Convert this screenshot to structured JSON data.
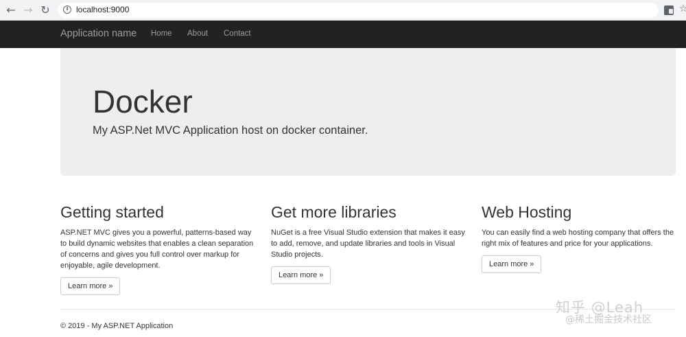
{
  "browser": {
    "back_icon": "←",
    "forward_icon": "→",
    "reload_icon": "↻",
    "info_icon": "i",
    "url": "localhost:9000",
    "star_icon": "☆"
  },
  "navbar": {
    "brand": "Application name",
    "links": [
      "Home",
      "About",
      "Contact"
    ]
  },
  "jumbotron": {
    "title": "Docker",
    "lead": "My ASP.Net MVC Application host on docker container."
  },
  "columns": [
    {
      "heading": "Getting started",
      "body": "ASP.NET MVC gives you a powerful, patterns-based way to build dynamic websites that enables a clean separation of concerns and gives you full control over markup for enjoyable, agile development.",
      "button": "Learn more »"
    },
    {
      "heading": "Get more libraries",
      "body": "NuGet is a free Visual Studio extension that makes it easy to add, remove, and update libraries and tools in Visual Studio projects.",
      "button": "Learn more »"
    },
    {
      "heading": "Web Hosting",
      "body": "You can easily find a web hosting company that offers the right mix of features and price for your applications.",
      "button": "Learn more »"
    }
  ],
  "footer": "© 2019 - My ASP.NET Application",
  "watermark": {
    "line1": "知乎 @Leah",
    "line2": "@稀土掘金技术社区"
  }
}
